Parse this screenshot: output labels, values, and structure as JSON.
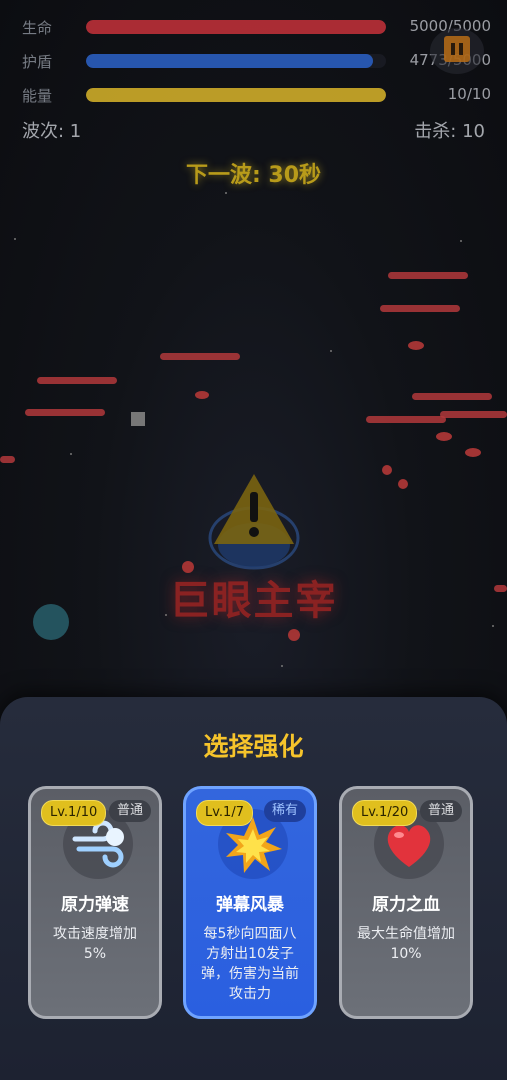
{
  "hud": {
    "hp": {
      "label": "生命",
      "value": "5000/5000",
      "fraction": 1.0,
      "color": "#c6323a"
    },
    "shield": {
      "label": "护盾",
      "value": "4773/5000",
      "fraction": 0.955,
      "color": "#2c63c9"
    },
    "energy": {
      "label": "能量",
      "value": "10/10",
      "fraction": 1.0,
      "color": "#d9b52a"
    },
    "wave": "波次: 1",
    "kills": "击杀: 10",
    "next_wave": "下一波: 30秒",
    "pause_icon": "pause-icon"
  },
  "battlefield": {
    "boss_name": "巨眼主宰",
    "warning_icon": "warning-triangle-icon"
  },
  "upgrade_panel": {
    "title": "选择强化",
    "cards": [
      {
        "level": "Lv.1/10",
        "rarity": "普通",
        "icon": "wind-icon",
        "name": "原力弹速",
        "desc": "攻击速度增加5%",
        "tier": "common"
      },
      {
        "level": "Lv.1/7",
        "rarity": "稀有",
        "icon": "explosion-icon",
        "name": "弹幕风暴",
        "desc": "每5秒向四面八方射出10发子弹，伤害为当前攻击力",
        "tier": "rare"
      },
      {
        "level": "Lv.1/20",
        "rarity": "普通",
        "icon": "heart-icon",
        "name": "原力之血",
        "desc": "最大生命值增加10%",
        "tier": "common"
      }
    ]
  }
}
